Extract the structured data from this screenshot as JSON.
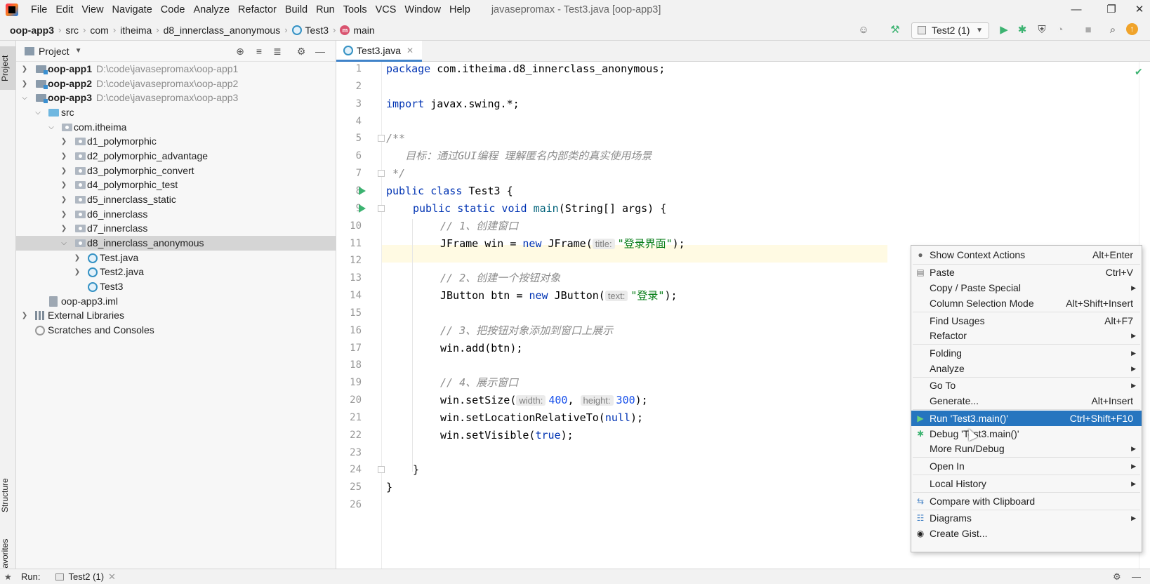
{
  "menubar": {
    "items": [
      "File",
      "Edit",
      "View",
      "Navigate",
      "Code",
      "Analyze",
      "Refactor",
      "Build",
      "Run",
      "Tools",
      "VCS",
      "Window",
      "Help"
    ],
    "window_title": "javasepromax - Test3.java [oop-app3]"
  },
  "navbar": {
    "crumbs": [
      "oop-app3",
      "src",
      "com",
      "itheima",
      "d8_innerclass_anonymous",
      "Test3",
      "main"
    ],
    "run_config": "Test2 (1)"
  },
  "left_strip": {
    "project": "Project",
    "structure": "Structure",
    "favorites": "Favorites"
  },
  "project": {
    "title": "Project",
    "rows": [
      {
        "label": "oop-app1",
        "path": "D:\\code\\javasepromax\\oop-app1"
      },
      {
        "label": "oop-app2",
        "path": "D:\\code\\javasepromax\\oop-app2"
      },
      {
        "label": "oop-app3",
        "path": "D:\\code\\javasepromax\\oop-app3"
      },
      {
        "label": "src"
      },
      {
        "label": "com.itheima"
      },
      {
        "label": "d1_polymorphic"
      },
      {
        "label": "d2_polymorphic_advantage"
      },
      {
        "label": "d3_polymorphic_convert"
      },
      {
        "label": "d4_polymorphic_test"
      },
      {
        "label": "d5_innerclass_static"
      },
      {
        "label": "d6_innerclass"
      },
      {
        "label": "d7_innerclass"
      },
      {
        "label": "d8_innerclass_anonymous"
      },
      {
        "label": "Test.java"
      },
      {
        "label": "Test2.java"
      },
      {
        "label": "Test3"
      },
      {
        "label": "oop-app3.iml"
      },
      {
        "label": "External Libraries"
      },
      {
        "label": "Scratches and Consoles"
      }
    ]
  },
  "editor": {
    "tab": "Test3.java",
    "line_numbers": [
      "1",
      "2",
      "3",
      "4",
      "5",
      "6",
      "7",
      "8",
      "9",
      "10",
      "11",
      "12",
      "13",
      "14",
      "15",
      "16",
      "17",
      "18",
      "19",
      "20",
      "21",
      "22",
      "23",
      "24",
      "25",
      "26"
    ],
    "code": {
      "l1_kw": "package",
      "l1_rest": " com.itheima.d8_innerclass_anonymous;",
      "l3_kw": "import",
      "l3_rest": " javax.swing.*;",
      "l5": "/**",
      "l6_a": "   目标：通过",
      "l6_b": "GUI",
      "l6_c": "编程 理解匿名内部类的真实使用场景",
      "l7": " */",
      "l8_kw": "public class",
      "l8_rest": " Test3 {",
      "l9_kw": "public static void",
      "l9_fn": "main",
      "l9_rest": "(String[] args) {",
      "l10": "// 1、创建窗口",
      "l11_a": "JFrame win = ",
      "l11_kw": "new",
      "l11_b": " JFrame(",
      "l11_hint": "title:",
      "l11_str": "\"登录界面\"",
      "l11_c": ");",
      "l13": "// 2、创建一个按钮对象",
      "l14_a": "JButton btn = ",
      "l14_kw": "new",
      "l14_b": " JButton(",
      "l14_hint": "text:",
      "l14_str": "\"登录\"",
      "l14_c": ");",
      "l16": "// 3、把按钮对象添加到窗口上展示",
      "l17": "win.add(btn);",
      "l19": "// 4、展示窗口",
      "l20_a": "win.setSize(",
      "l20_hint1": "width:",
      "l20_n1": "400",
      "l20_sep": ", ",
      "l20_hint2": "height:",
      "l20_n2": "300",
      "l20_c": ");",
      "l21_a": "win.setLocationRelativeTo(",
      "l21_kw": "null",
      "l21_c": ");",
      "l22_a": "win.setVisible(",
      "l22_kw": "true",
      "l22_c": ");",
      "l24": "}",
      "l25": "}"
    }
  },
  "context_menu": {
    "items": [
      {
        "label": "Show Context Actions",
        "shortcut": "Alt+Enter"
      },
      {
        "label": "Paste",
        "shortcut": "Ctrl+V"
      },
      {
        "label": "Copy / Paste Special",
        "shortcut": ""
      },
      {
        "label": "Column Selection Mode",
        "shortcut": "Alt+Shift+Insert"
      },
      {
        "label": "Find Usages",
        "shortcut": "Alt+F7"
      },
      {
        "label": "Refactor",
        "shortcut": ""
      },
      {
        "label": "Folding",
        "shortcut": ""
      },
      {
        "label": "Analyze",
        "shortcut": ""
      },
      {
        "label": "Go To",
        "shortcut": ""
      },
      {
        "label": "Generate...",
        "shortcut": "Alt+Insert"
      },
      {
        "label": "Run 'Test3.main()'",
        "shortcut": "Ctrl+Shift+F10"
      },
      {
        "label": "Debug 'Test3.main()'",
        "shortcut": ""
      },
      {
        "label": "More Run/Debug",
        "shortcut": ""
      },
      {
        "label": "Open In",
        "shortcut": ""
      },
      {
        "label": "Local History",
        "shortcut": ""
      },
      {
        "label": "Compare with Clipboard",
        "shortcut": ""
      },
      {
        "label": "Diagrams",
        "shortcut": ""
      },
      {
        "label": "Create Gist...",
        "shortcut": ""
      }
    ]
  },
  "bottom": {
    "run_label": "Run:",
    "run_tab": "Test2 (1)"
  },
  "colors": {
    "accent": "#2675bf",
    "keyword": "#0033b3",
    "string": "#067d17",
    "comment": "#8c8c8c",
    "run_green": "#3cb371"
  }
}
